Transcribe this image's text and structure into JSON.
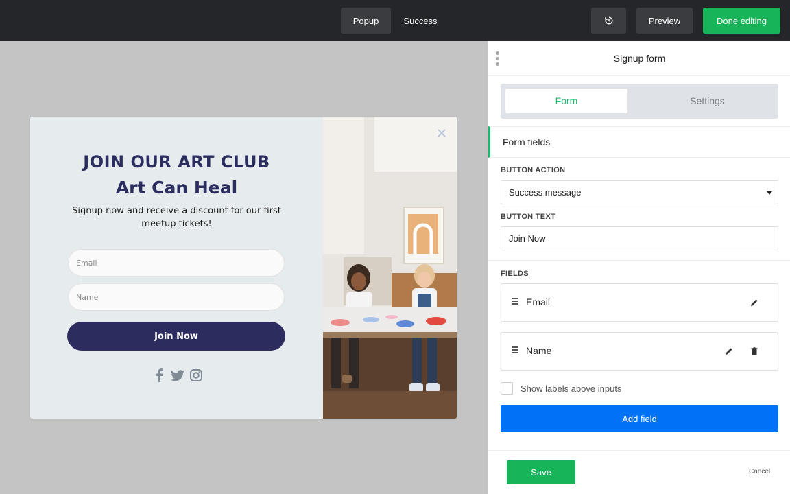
{
  "topbar": {
    "tabs": [
      {
        "label": "Popup",
        "active": true
      },
      {
        "label": "Success",
        "active": false
      }
    ],
    "undo_icon": "history-icon",
    "preview_label": "Preview",
    "done_label": "Done editing"
  },
  "popup": {
    "title": "JOIN OUR ART CLUB",
    "subtitle": "Art Can Heal",
    "description": "Signup now and receive a discount for our first meetup tickets!",
    "email_placeholder": "Email",
    "name_placeholder": "Name",
    "cta_label": "Join Now",
    "socials": [
      "facebook-icon",
      "twitter-icon",
      "instagram-icon"
    ],
    "close_icon": "close-icon",
    "image_subject": "photo-of-children-making-art"
  },
  "panel": {
    "title": "Signup form",
    "tabs": [
      {
        "label": "Form",
        "active": true
      },
      {
        "label": "Settings",
        "active": false
      }
    ],
    "section_title": "Form fields",
    "button_action_label": "BUTTON ACTION",
    "button_action_value": "Success message",
    "button_text_label": "BUTTON TEXT",
    "button_text_value": "Join Now",
    "fields_label": "FIELDS",
    "fields": [
      {
        "label": "Email",
        "editable": true,
        "deletable": false
      },
      {
        "label": "Name",
        "editable": true,
        "deletable": true
      }
    ],
    "show_labels_text": "Show labels above inputs",
    "show_labels_checked": false,
    "add_field_label": "Add field",
    "save_label": "Save",
    "cancel_label": "Cancel"
  },
  "colors": {
    "accent_green": "#17b45a",
    "primary_blue": "#0072f5",
    "popup_navy": "#2c2d5e",
    "topbar_bg": "#24262a"
  }
}
